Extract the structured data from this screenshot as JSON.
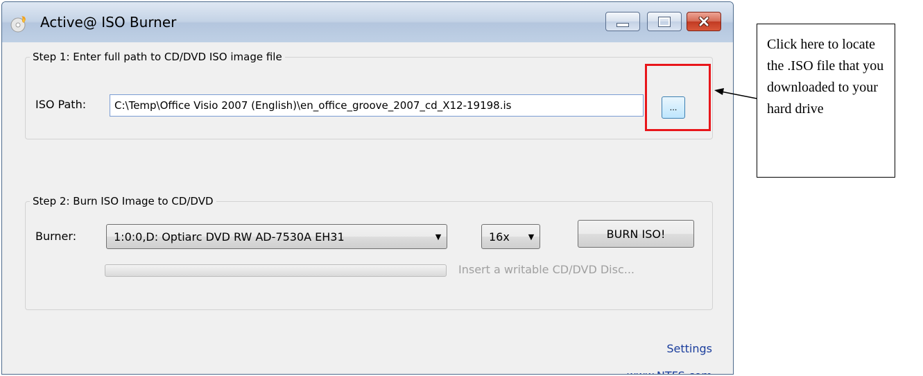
{
  "window": {
    "title": "Active@ ISO Burner",
    "controls": [
      "minimize",
      "maximize",
      "close"
    ]
  },
  "step1": {
    "legend": "Step 1: Enter full path to CD/DVD ISO image file",
    "iso_path_label": "ISO Path:",
    "iso_path_value": "C:\\Temp\\Office Visio 2007 (English)\\en_office_groove_2007_cd_X12-19198.is",
    "browse_label": "..."
  },
  "step2": {
    "legend": "Step 2: Burn ISO Image to CD/DVD",
    "burner_label": "Burner:",
    "burner_value": "1:0:0,D: Optiarc  DVD RW AD-7530A  EH31",
    "speed_value": "16x",
    "burn_button": "BURN ISO!",
    "progress": 0,
    "status_text": "Insert a writable CD/DVD Disc..."
  },
  "footer": {
    "settings_link": "Settings",
    "website_link": "www.NTFS.com"
  },
  "callout": {
    "text": "Click here to locate the .ISO file that you downloaded to your hard drive"
  },
  "colors": {
    "highlight_box": "#e8161b",
    "link": "#1a3d9c",
    "status_text": "#a0a0a0"
  }
}
